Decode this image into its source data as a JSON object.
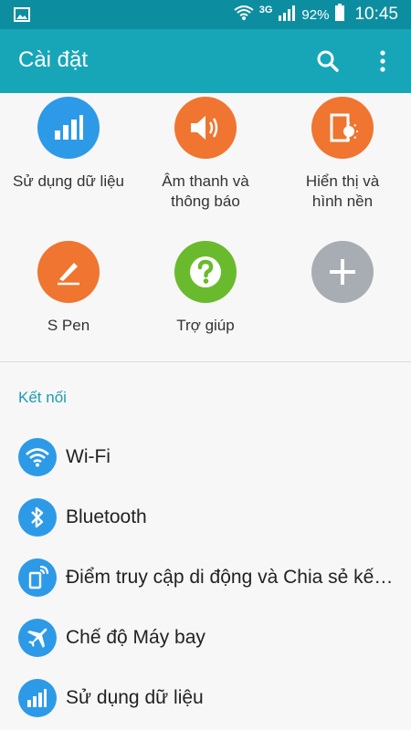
{
  "status_bar": {
    "network": "3G",
    "battery": "92%",
    "time": "10:45"
  },
  "app_bar": {
    "title": "Cài đặt"
  },
  "quick_settings": [
    {
      "label": "Sử dụng dữ liệu",
      "icon": "data-usage-icon",
      "color": "#2d9ae8"
    },
    {
      "label": "Âm thanh và thông báo",
      "icon": "sound-icon",
      "color": "#ef7530"
    },
    {
      "label": "Hiển thị và hình nền",
      "icon": "display-icon",
      "color": "#ef7530"
    },
    {
      "label": "S Pen",
      "icon": "s-pen-icon",
      "color": "#ef7530"
    },
    {
      "label": "Trợ giúp",
      "icon": "help-icon",
      "color": "#6aba2e"
    },
    {
      "label": "",
      "icon": "add-icon",
      "color": "#a7adb2"
    }
  ],
  "section": {
    "title": "Kết nối"
  },
  "list": [
    {
      "label": "Wi-Fi",
      "icon": "wifi-icon"
    },
    {
      "label": "Bluetooth",
      "icon": "bluetooth-icon"
    },
    {
      "label": "Điểm truy cập di động và Chia sẻ kết nối",
      "icon": "hotspot-icon"
    },
    {
      "label": "Chế độ Máy bay",
      "icon": "airplane-icon"
    },
    {
      "label": "Sử dụng dữ liệu",
      "icon": "data-usage-icon"
    }
  ]
}
